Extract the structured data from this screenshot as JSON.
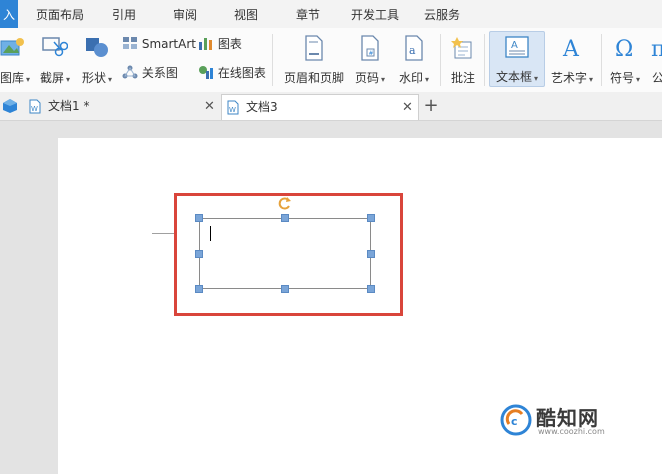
{
  "menu": {
    "tabs": [
      "入",
      "页面布局",
      "引用",
      "审阅",
      "视图",
      "章节",
      "开发工具",
      "云服务"
    ]
  },
  "ribbon": {
    "gallery": "图库",
    "screenshot": "截屏",
    "shapes": "形状",
    "smartart": "SmartArt",
    "chart": "图表",
    "relation": "关系图",
    "online_chart": "在线图表",
    "header_footer": "页眉和页脚",
    "page_number": "页码",
    "watermark": "水印",
    "comment": "批注",
    "textbox": "文本框",
    "wordart": "艺术字",
    "symbol": "符号",
    "formula": "公"
  },
  "doc_tabs": [
    {
      "title": "文档1 *"
    },
    {
      "title": "文档3"
    }
  ],
  "watermark": {
    "brand": "酷知网",
    "url": "www.coozhi.com"
  },
  "colors": {
    "accent": "#2e84d6",
    "highlight": "#d9453b",
    "handle": "#7aa5d8"
  }
}
